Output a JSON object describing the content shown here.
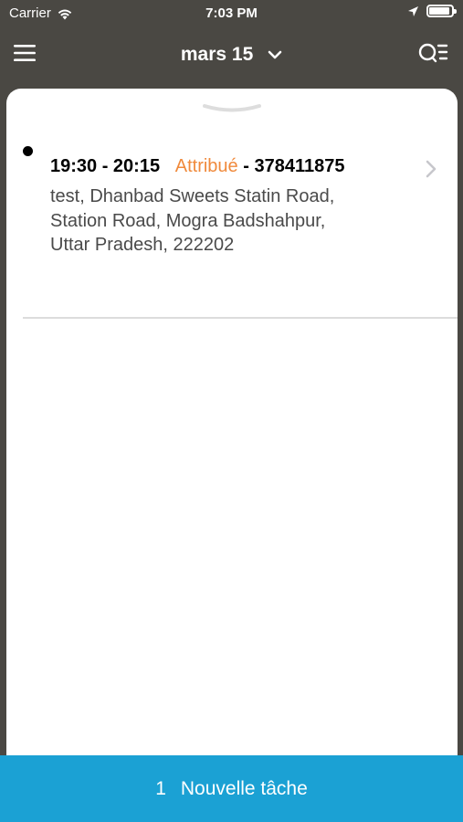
{
  "status_bar": {
    "carrier": "Carrier",
    "time": "7:03 PM"
  },
  "navbar": {
    "date_label": "mars 15",
    "menu_icon": "hamburger-menu-icon",
    "filter_icon": "search-list-icon"
  },
  "tasks": [
    {
      "time_range": "19:30 - 20:15",
      "status": "Attribué",
      "separator": " - ",
      "task_id": "378411875",
      "address_lines": [
        "test, Dhanbad Sweets Statin Road,",
        "Station Road, Mogra Badshahpur,",
        "Uttar Pradesh, 222202"
      ]
    }
  ],
  "footer": {
    "count": "1",
    "label": "Nouvelle tâche"
  },
  "colors": {
    "navbar_bg": "#4a4843",
    "status_orange": "#f08a3c",
    "button_blue": "#1ba1d4"
  }
}
